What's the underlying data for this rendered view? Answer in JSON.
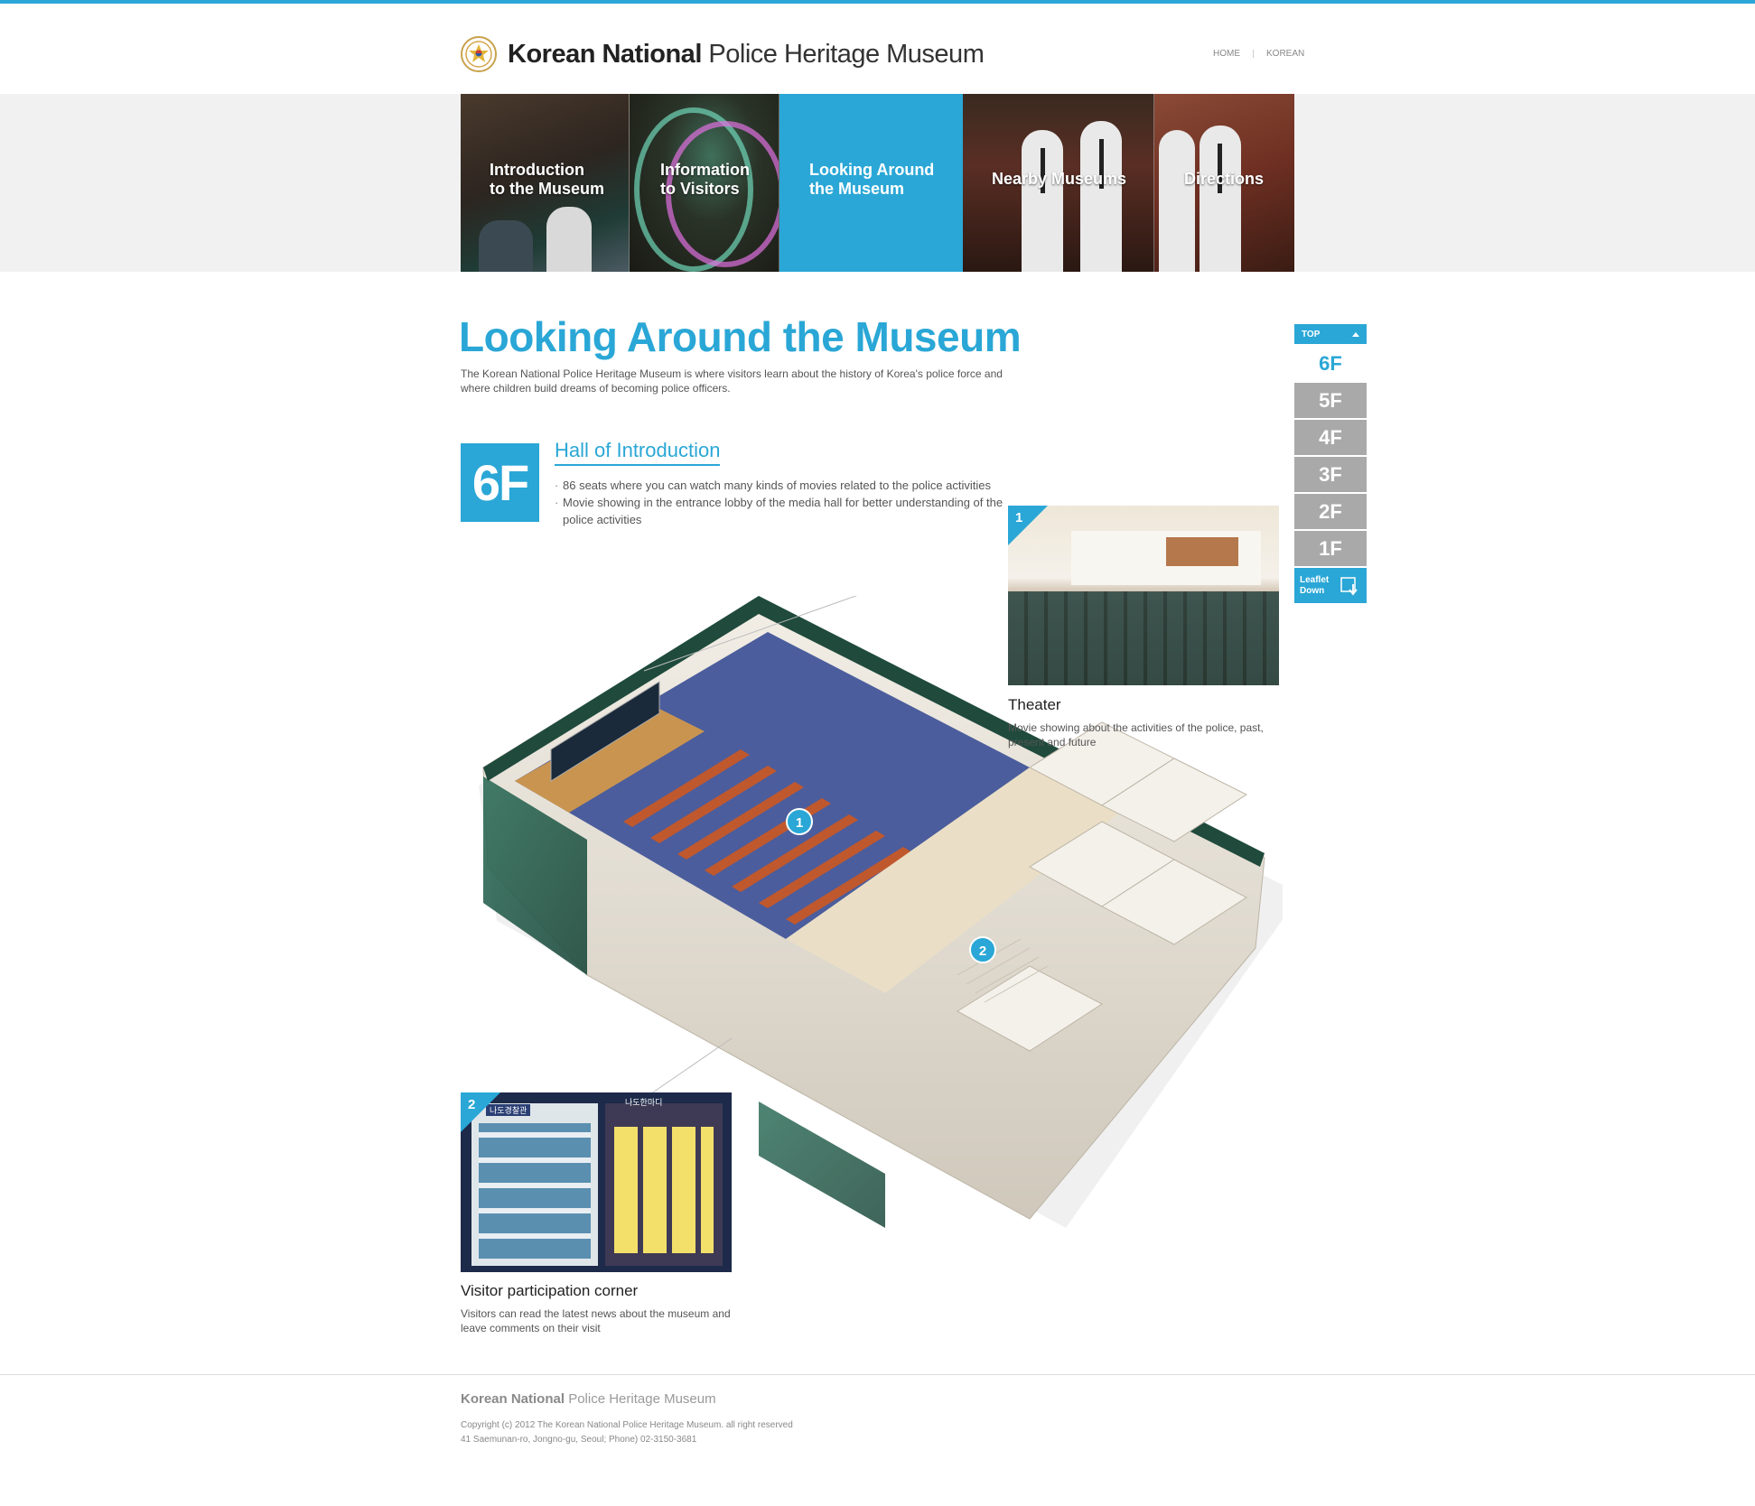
{
  "header": {
    "logo_bold": "Korean National",
    "logo_rest": " Police Heritage Museum",
    "links": [
      "HOME",
      "KOREAN"
    ]
  },
  "nav": [
    {
      "label": "Introduction\nto the Museum"
    },
    {
      "label": "Information\nto Visitors"
    },
    {
      "label": "Looking Around\nthe Museum"
    },
    {
      "label": "Nearby Museums"
    },
    {
      "label": "Directions"
    }
  ],
  "page": {
    "title": "Looking Around the Museum",
    "description": "The Korean National Police Heritage Museum is where visitors learn about the history of Korea's police force and where children build dreams of becoming police officers."
  },
  "floor": {
    "badge": "6F",
    "hall_title": "Hall of Introduction",
    "bullets": [
      "86 seats where you can watch many kinds of movies related to the police activities",
      "Movie showing in the entrance lobby of the media hall for better understanding of the police activities"
    ]
  },
  "spots": [
    {
      "number": "1",
      "title": "Theater",
      "description": "Movie showing about the activities of the police, past, present and future"
    },
    {
      "number": "2",
      "title": "Visitor participation corner",
      "description": "Visitors can read the latest news about the museum and leave comments on their visit"
    }
  ],
  "photo2_signs": {
    "left": "나도경찰관",
    "right": "나도한마디"
  },
  "sidenav": {
    "top_label": "TOP",
    "floors": [
      "6F",
      "5F",
      "4F",
      "3F",
      "2F",
      "1F"
    ],
    "active": "6F",
    "leaflet_label": "Leaflet Down"
  },
  "footer": {
    "logo_bold": "Korean National",
    "logo_rest": " Police Heritage Museum",
    "copyright": "Copyright (c) 2012 The Korean National Police Heritage Museum. all right reserved",
    "address": "41 Saemunan-ro, Jongno-gu, Seoul; Phone) 02-3150-3681"
  },
  "colors": {
    "accent": "#2aa7d6",
    "inactive_floor": "#a9a9a9"
  }
}
